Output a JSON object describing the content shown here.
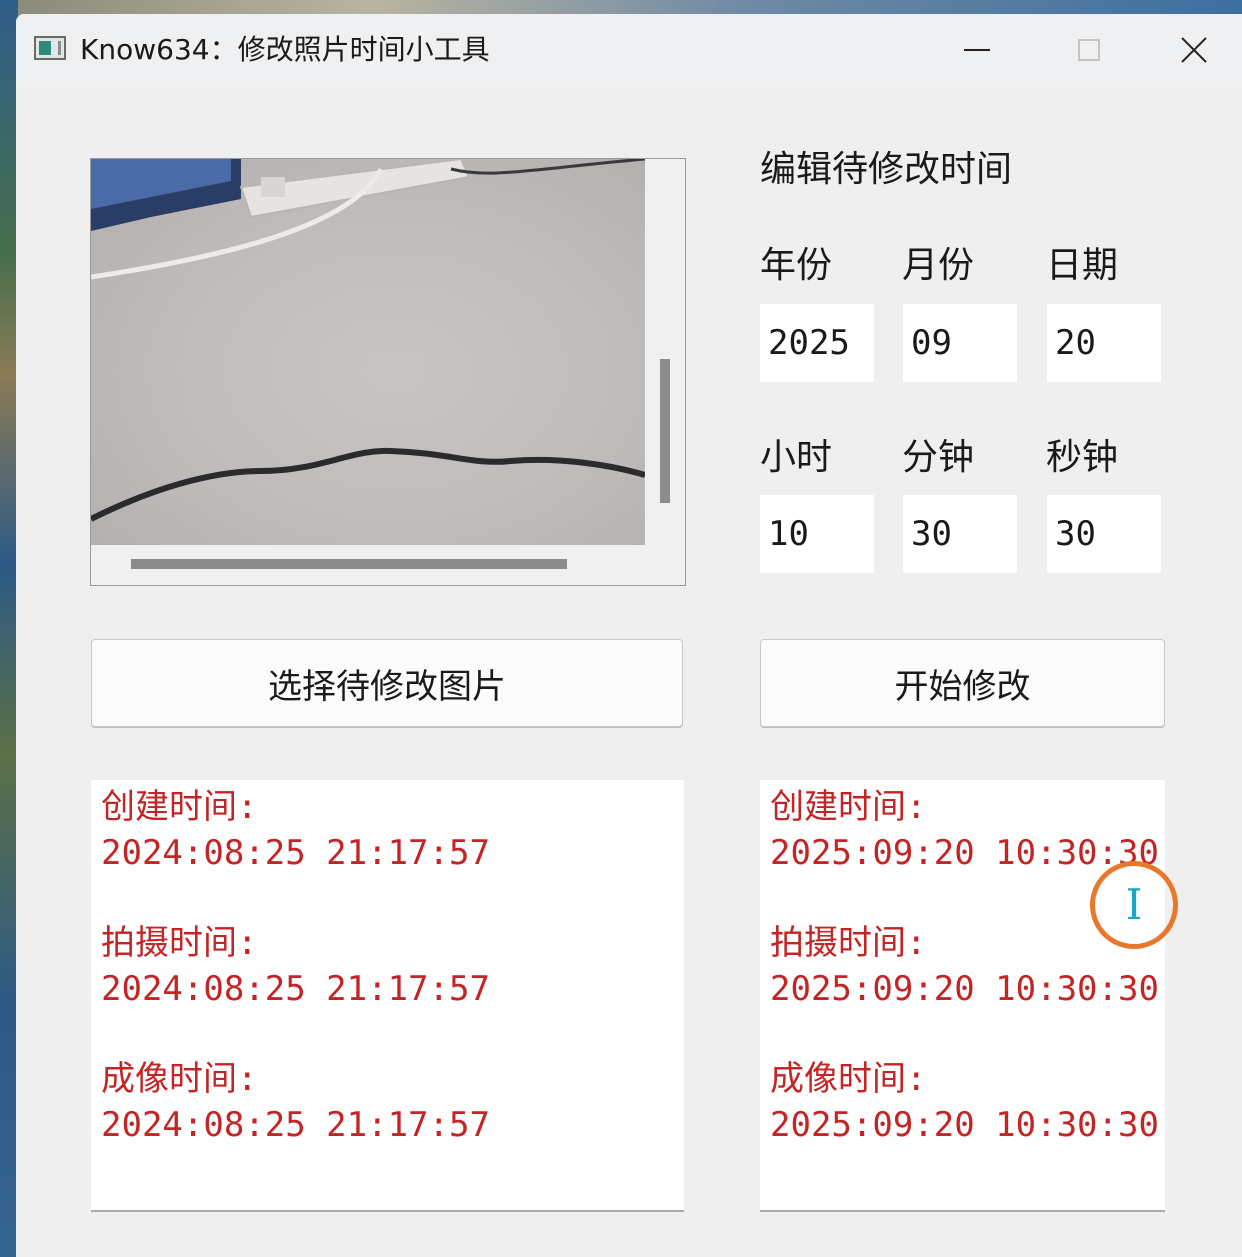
{
  "window": {
    "title": "Know634：修改照片时间小工具"
  },
  "editor": {
    "section_title": "编辑待修改时间",
    "fields": {
      "year": {
        "label": "年份",
        "value": "2025"
      },
      "month": {
        "label": "月份",
        "value": "09"
      },
      "day": {
        "label": "日期",
        "value": "20"
      },
      "hour": {
        "label": "小时",
        "value": "10"
      },
      "minute": {
        "label": "分钟",
        "value": "30"
      },
      "second": {
        "label": "秒钟",
        "value": "30"
      }
    }
  },
  "buttons": {
    "select_image": "选择待修改图片",
    "start_modify": "开始修改"
  },
  "original_info": {
    "create_label": "创建时间:",
    "create_value": "2024:08:25 21:17:57",
    "shot_label": "拍摄时间:",
    "shot_value": "2024:08:25 21:17:57",
    "digitized_label": "成像时间:",
    "digitized_value": "2024:08:25 21:17:57"
  },
  "modified_info": {
    "create_label": "创建时间:",
    "create_value": "2025:09:20 10:30:30",
    "shot_label": "拍摄时间:",
    "shot_value": "2025:09:20 10:30:30",
    "digitized_label": "成像时间:",
    "digitized_value": "2025:09:20 10:30:30"
  },
  "colors": {
    "info_text": "#c42424",
    "cursor_ring": "#e8782a",
    "cursor_ibeam": "#1aa6c8"
  },
  "icons": {
    "app": "app-icon",
    "minimize": "minimize-icon",
    "maximize": "maximize-icon",
    "close": "close-icon",
    "cursor": "text-cursor-icon"
  }
}
